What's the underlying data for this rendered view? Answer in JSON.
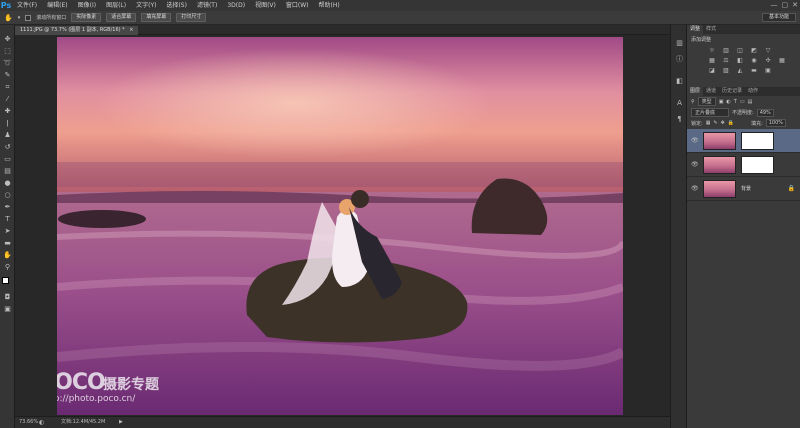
{
  "app": {
    "logo": "Ps"
  },
  "menu": [
    "文件(F)",
    "编辑(E)",
    "图像(I)",
    "图层(L)",
    "文字(Y)",
    "选择(S)",
    "滤镜(T)",
    "3D(D)",
    "视图(V)",
    "窗口(W)",
    "帮助(H)"
  ],
  "window_controls": [
    "—",
    "▢",
    "✕"
  ],
  "options": {
    "checkbox_label": "滚动所有窗口",
    "buttons": [
      "实际像素",
      "适合屏幕",
      "填充屏幕",
      "打印尺寸"
    ],
    "workspace": "基本功能"
  },
  "document": {
    "tab_title": "1111.JPG @ 73.7% (图层 1 副本, RGB/16) *",
    "tab_close": "×"
  },
  "status": {
    "zoom": "73.66%",
    "doc_info": "文档:12.4M/45.2M"
  },
  "watermark": {
    "brand": "POCO",
    "cn": "摄影专题",
    "url": "http://photo.poco.cn/"
  },
  "panels": {
    "top_tabs": [
      "调整",
      "样式"
    ],
    "adjust_label": "添加调整",
    "layers_tabs": [
      "图层",
      "通道",
      "历史记录",
      "动作"
    ],
    "kind_label": "类型",
    "blend_mode": "正片叠底",
    "opacity_label": "不透明度:",
    "opacity_value": "49%",
    "lock_label": "锁定:",
    "fill_label": "填充:",
    "fill_value": "100%",
    "layers": [
      {
        "name": "",
        "has_mask": true,
        "selected": true
      },
      {
        "name": "",
        "has_mask": true,
        "selected": false
      },
      {
        "name": "背景",
        "has_mask": false,
        "selected": false
      }
    ]
  },
  "icons": {
    "eye": "eye-icon",
    "lock": "lock-icon"
  }
}
